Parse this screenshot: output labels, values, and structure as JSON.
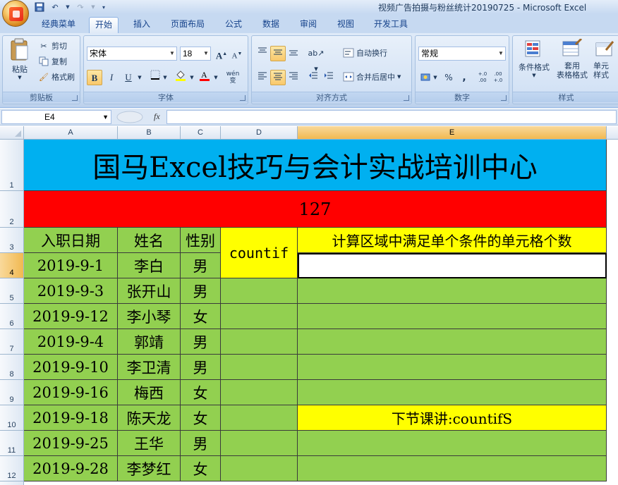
{
  "window": {
    "title": "视频广告拍摄与粉丝统计20190725 - Microsoft Excel"
  },
  "ribbon_tabs": [
    {
      "label": "经典菜单"
    },
    {
      "label": "开始"
    },
    {
      "label": "插入"
    },
    {
      "label": "页面布局"
    },
    {
      "label": "公式"
    },
    {
      "label": "数据"
    },
    {
      "label": "审阅"
    },
    {
      "label": "视图"
    },
    {
      "label": "开发工具"
    }
  ],
  "active_tab": "开始",
  "clipboard": {
    "paste": "粘贴",
    "cut": "剪切",
    "copy": "复制",
    "format_painter": "格式刷",
    "group_label": "剪贴板"
  },
  "font": {
    "name": "宋体",
    "size": "18",
    "grow": "A",
    "shrink": "A",
    "bold": "B",
    "italic": "I",
    "underline": "U",
    "phonetic": "wén 变",
    "group_label": "字体"
  },
  "alignment": {
    "wrap_text": "自动换行",
    "merge_center": "合并后居中",
    "group_label": "对齐方式"
  },
  "number": {
    "format": "常规",
    "percent": "%",
    "comma": ",",
    "inc_decimal": "+.0 .00",
    "dec_decimal": ".00 +.0",
    "group_label": "数字"
  },
  "styles": {
    "conditional": "条件格式",
    "table_format_1": "套用",
    "table_format_2": "表格格式",
    "cell_styles_1": "单元",
    "cell_styles_2": "样式",
    "group_label": "样式"
  },
  "formula_bar": {
    "name_box": "E4",
    "fx": "fx",
    "content": ""
  },
  "columns": [
    "A",
    "B",
    "C",
    "D",
    "E"
  ],
  "selected_column": "E",
  "rows": [
    "1",
    "2",
    "3",
    "4",
    "5",
    "6",
    "7",
    "8",
    "9",
    "10",
    "11",
    "12"
  ],
  "selected_row": "4",
  "sheet": {
    "title": "国马Excel技巧与会计实战培训中心",
    "number": "127",
    "headers": {
      "date": "入职日期",
      "name": "姓名",
      "gender": "性别"
    },
    "function_label": "countif",
    "description": "计算区域中满足单个条件的单元格个数",
    "next_lesson": "下节课讲:countifS",
    "records": [
      {
        "date": "2019-9-1",
        "name": "李白",
        "gender": "男"
      },
      {
        "date": "2019-9-3",
        "name": "张开山",
        "gender": "男"
      },
      {
        "date": "2019-9-12",
        "name": "李小琴",
        "gender": "女"
      },
      {
        "date": "2019-9-4",
        "name": "郭靖",
        "gender": "男"
      },
      {
        "date": "2019-9-10",
        "name": "李卫清",
        "gender": "男"
      },
      {
        "date": "2019-9-16",
        "name": "梅西",
        "gender": "女"
      },
      {
        "date": "2019-9-18",
        "name": "陈天龙",
        "gender": "女"
      },
      {
        "date": "2019-9-25",
        "name": "王华",
        "gender": "男"
      },
      {
        "date": "2019-9-28",
        "name": "李梦红",
        "gender": "女"
      }
    ]
  },
  "colors": {
    "title_fill": "#00b0f0",
    "number_fill": "#ff0000",
    "header_fill": "#92d050",
    "highlight_fill": "#ffff00"
  }
}
